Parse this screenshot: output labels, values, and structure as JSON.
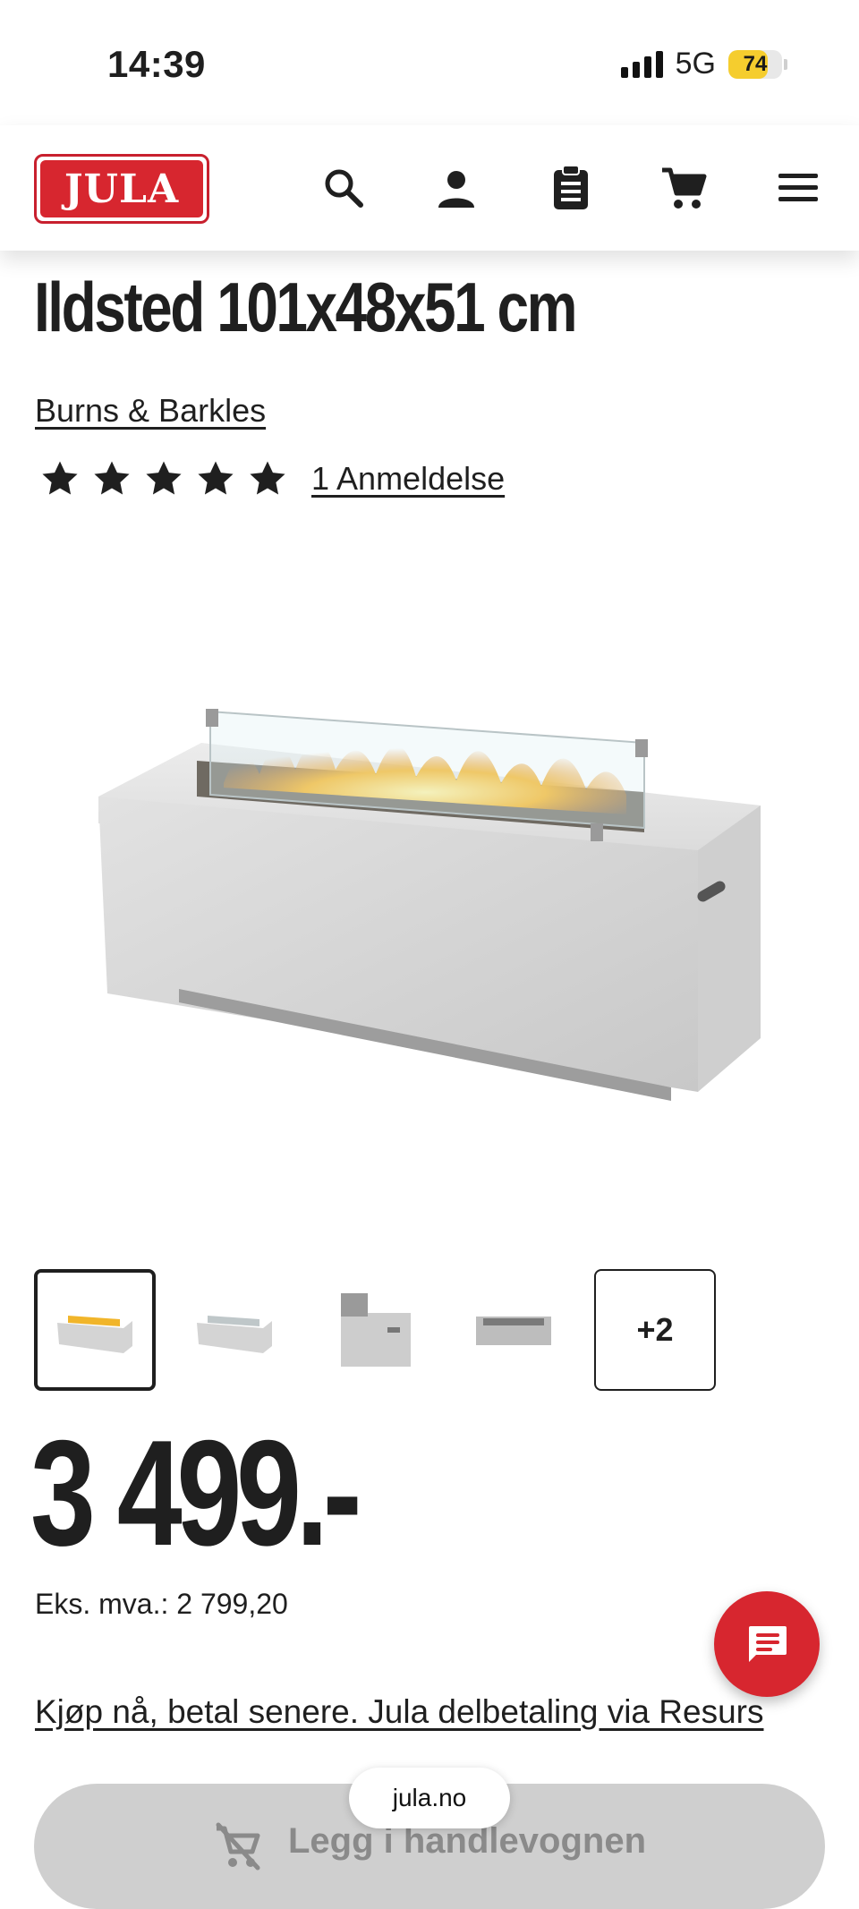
{
  "status_bar": {
    "time": "14:39",
    "network": "5G",
    "battery": "74",
    "battery_fraction": 0.74
  },
  "header": {
    "logo_text": "JULA",
    "icons": [
      "search-icon",
      "account-icon",
      "shopping-list-icon",
      "cart-icon",
      "menu-icon"
    ]
  },
  "product": {
    "title": "Ildsted 101x48x51 cm",
    "brand": "Burns & Barkles",
    "rating_stars": 5,
    "reviews_label": "1 Anmeldelse",
    "price": "3 499.-",
    "price_ex_vat": "Eks. mva.: 2 799,20",
    "pay_later": "Kjøp nå, betal senere. Jula delbetaling via Resurs",
    "more_images": "+2"
  },
  "cart_button": {
    "label": "Legg i handlevognen"
  },
  "browser": {
    "url": "jula.no"
  },
  "colors": {
    "brand_red": "#d7262f",
    "text": "#1f1f1f",
    "disabled_button": "#cfcfcf"
  }
}
